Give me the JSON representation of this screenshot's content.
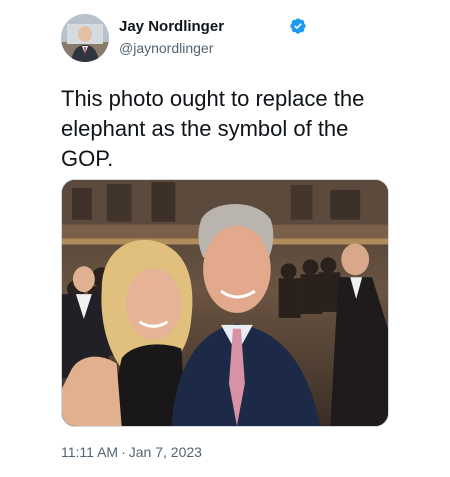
{
  "author": {
    "name": "Jay Nordlinger",
    "handle": "@jaynordlinger",
    "verified": true,
    "verified_color": "#1d9bf0",
    "avatar_icon": "profile-photo"
  },
  "tweet": {
    "text": "This photo ought to replace the elephant as the symbol of the GOP."
  },
  "media": {
    "kind": "photo",
    "icon": "selfie-photo"
  },
  "meta": {
    "time": "11:11 AM",
    "separator": "·",
    "date": "Jan 7, 2023"
  },
  "colors": {
    "text_primary": "#0f1419",
    "text_secondary": "#536471",
    "border": "#cfd9de"
  }
}
